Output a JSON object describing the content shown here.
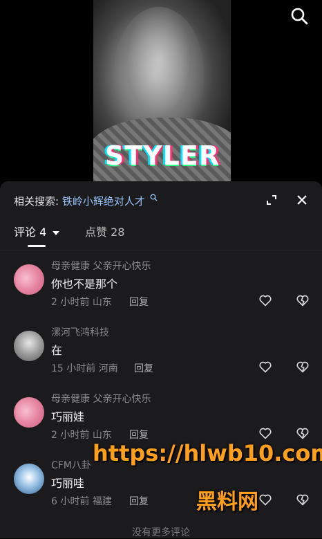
{
  "video": {
    "overlay_text": "STYLER"
  },
  "related": {
    "prefix": "相关搜索:",
    "query": "铁岭小辉绝对人才"
  },
  "tabs": {
    "comments_label": "评论 4",
    "likes_label": "点赞 28"
  },
  "comments": [
    {
      "username": "母亲健康 父亲开心快乐",
      "text": "你也不是那个",
      "time": "2 小时前",
      "location": "山东",
      "reply": "回复"
    },
    {
      "username": "漯河飞鸿科技",
      "text": "在",
      "time": "15 小时前",
      "location": "河南",
      "reply": "回复"
    },
    {
      "username": "母亲健康 父亲开心快乐",
      "text": "巧丽娃",
      "time": "2 小时前",
      "location": "山东",
      "reply": "回复"
    },
    {
      "username": "CFM八卦",
      "text": "巧丽哇",
      "time": "6 小时前",
      "location": "福建",
      "reply": "回复"
    }
  ],
  "footer": {
    "no_more": "没有更多评论"
  },
  "watermark": {
    "url": "https://hlwb10.com",
    "name": "黑料网"
  },
  "colors": {
    "panel_bg": "#1b1b1d",
    "link": "#9cc7ff",
    "watermark": "#ff9f1c"
  }
}
